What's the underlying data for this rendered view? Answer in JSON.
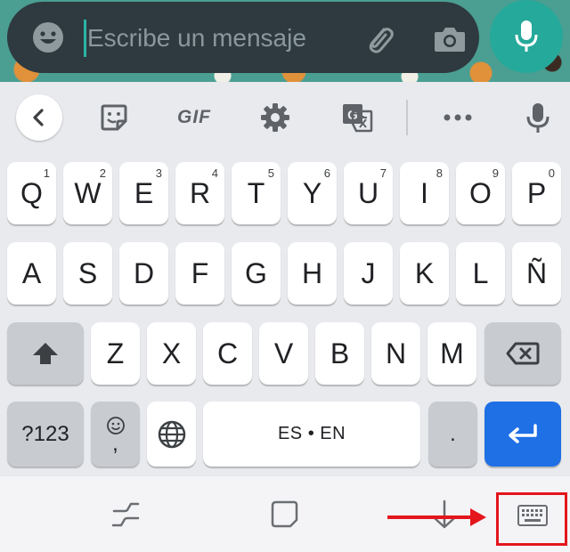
{
  "message_bar": {
    "placeholder": "Escribe un mensaje",
    "icons": [
      "emoji-icon",
      "paperclip-icon",
      "camera-icon",
      "microphone-icon"
    ]
  },
  "toolbar": {
    "gif_label": "GIF",
    "icons": [
      "chevron-left-icon",
      "sticker-icon",
      "gear-icon",
      "translate-icon",
      "more-horizontal-icon",
      "microphone-icon"
    ]
  },
  "keyboard": {
    "row1": [
      {
        "key": "Q",
        "hint": "1"
      },
      {
        "key": "W",
        "hint": "2"
      },
      {
        "key": "E",
        "hint": "3"
      },
      {
        "key": "R",
        "hint": "4"
      },
      {
        "key": "T",
        "hint": "5"
      },
      {
        "key": "Y",
        "hint": "6"
      },
      {
        "key": "U",
        "hint": "7"
      },
      {
        "key": "I",
        "hint": "8"
      },
      {
        "key": "O",
        "hint": "9"
      },
      {
        "key": "P",
        "hint": "0"
      }
    ],
    "row2": [
      "A",
      "S",
      "D",
      "F",
      "G",
      "H",
      "J",
      "K",
      "L",
      "Ñ"
    ],
    "row3": [
      "Z",
      "X",
      "C",
      "V",
      "B",
      "N",
      "M"
    ],
    "symbols_label": "?123",
    "comma_label": ",",
    "space_label": "ES • EN",
    "period_label": ".",
    "icons": [
      "shift-icon",
      "backspace-icon",
      "globe-icon",
      "enter-icon",
      "emoji-icon"
    ]
  },
  "colors": {
    "enter_key": "#1f6fe5",
    "mic_button": "#25a99a",
    "annotation": "#e4151c"
  },
  "nav_bar": {
    "icons": [
      "recent-apps-icon",
      "home-icon",
      "back-icon",
      "keyboard-icon"
    ],
    "annotation": "red arrow pointing to highlighted keyboard-icon"
  }
}
